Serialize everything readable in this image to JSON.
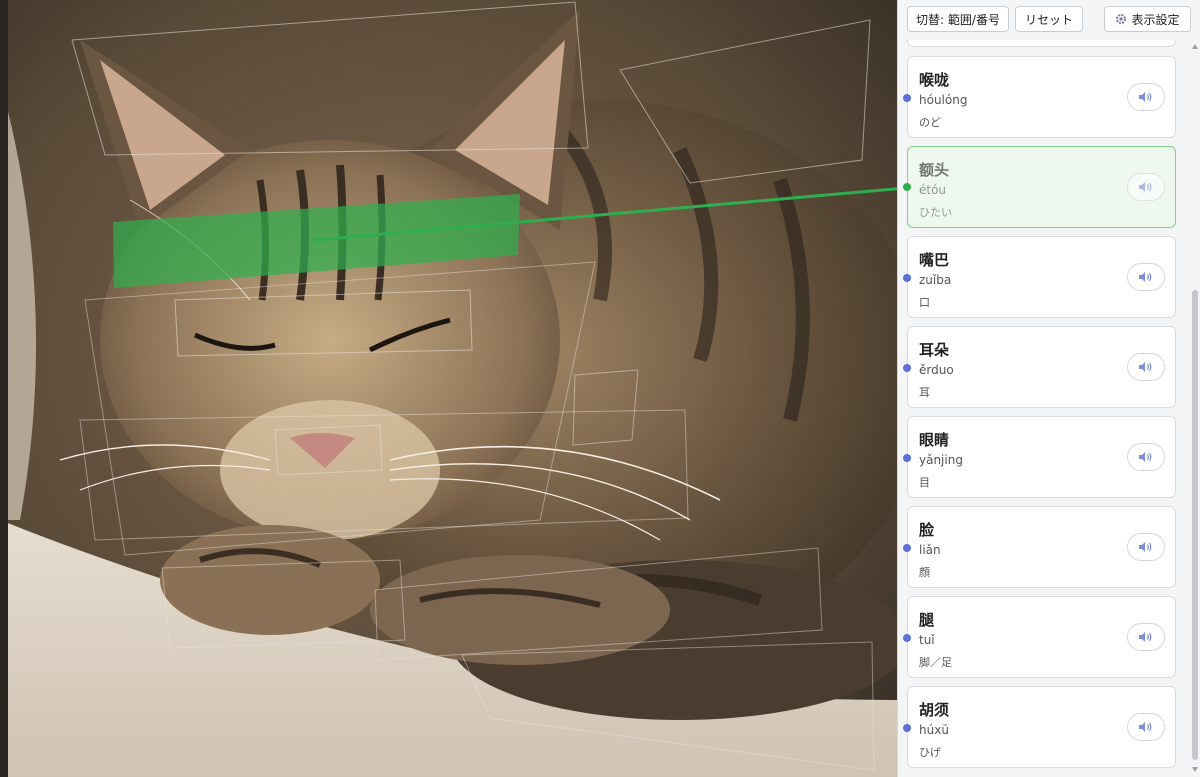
{
  "toolbar": {
    "switch_label": "切替: 範囲/番号",
    "reset_label": "リセット",
    "settings_label": "表示設定"
  },
  "cards": [
    {
      "hanzi": "喉咙",
      "pinyin": "hóulóng",
      "gloss": "のど"
    },
    {
      "hanzi": "额头",
      "pinyin": "étóu",
      "gloss": "ひたい"
    },
    {
      "hanzi": "嘴巴",
      "pinyin": "zuǐba",
      "gloss": "口"
    },
    {
      "hanzi": "耳朵",
      "pinyin": "ěrduo",
      "gloss": "耳"
    },
    {
      "hanzi": "眼睛",
      "pinyin": "yǎnjing",
      "gloss": "目"
    },
    {
      "hanzi": "脸",
      "pinyin": "liǎn",
      "gloss": "顔"
    },
    {
      "hanzi": "腿",
      "pinyin": "tuǐ",
      "gloss": "脚／足"
    },
    {
      "hanzi": "胡须",
      "pinyin": "húxū",
      "gloss": "ひげ"
    }
  ],
  "selected_card": "额头",
  "colors": {
    "highlight": "#2fae4f",
    "marker": "#5b6fd6",
    "selected_bg": "#eef8ef"
  },
  "icons": {
    "speaker": "speaker-icon",
    "settings": "gear-icon"
  }
}
